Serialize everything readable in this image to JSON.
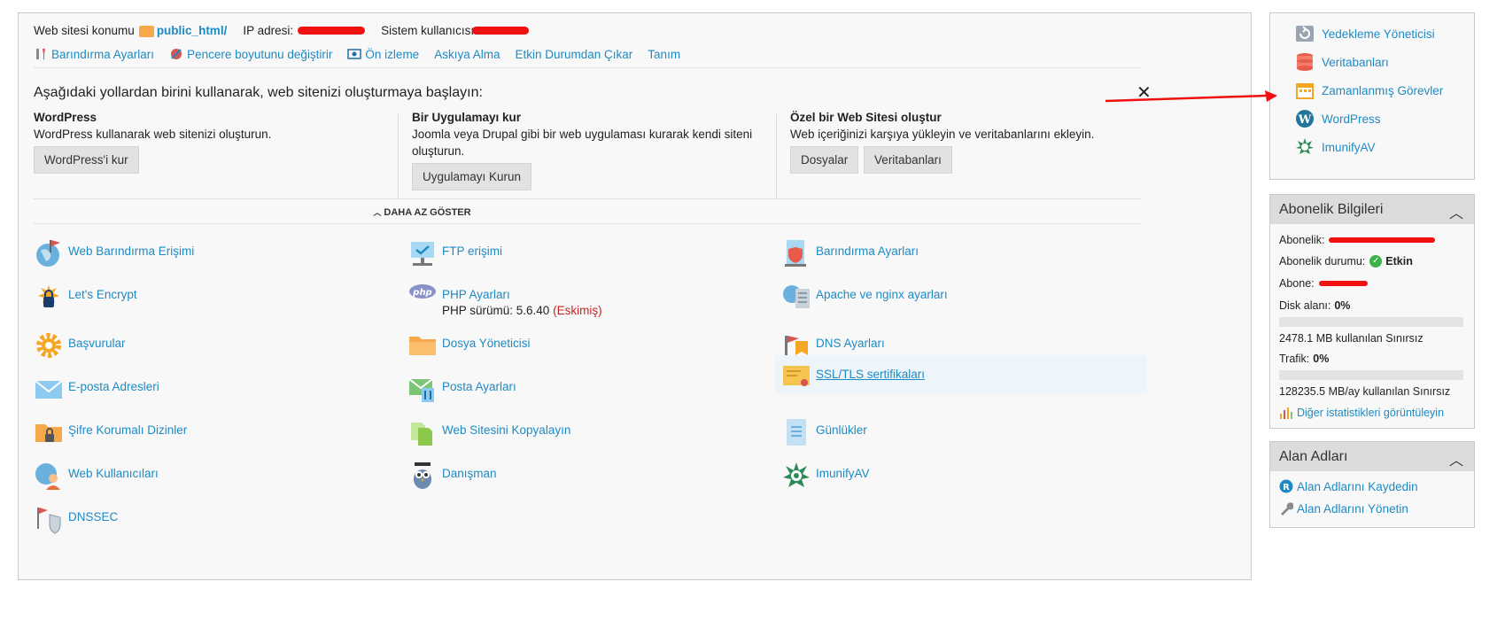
{
  "info": {
    "site_location_label": "Web sitesi konumu",
    "site_location_value": "public_html/",
    "ip_label": "IP adresi:",
    "system_user_label": "Sistem kullanıcısı:"
  },
  "toolbar": {
    "items": [
      {
        "label": "Barındırma Ayarları",
        "icon": "wrench-icon"
      },
      {
        "label": "Pencere boyutunu değiştirir",
        "icon": "resize-icon"
      },
      {
        "label": "Ön izleme",
        "icon": "eye-icon"
      },
      {
        "label": "Askıya Alma",
        "icon": ""
      },
      {
        "label": "Etkin Durumdan Çıkar",
        "icon": ""
      },
      {
        "label": "Tanım",
        "icon": ""
      }
    ]
  },
  "getting_started": {
    "title": "Aşağıdaki yollardan birini kullanarak, web sitenizi oluşturmaya başlayın:",
    "close": "✕",
    "columns": [
      {
        "title": "WordPress",
        "desc": "WordPress kullanarak web sitenizi oluşturun.",
        "buttons": [
          "WordPress'i kur"
        ]
      },
      {
        "title": "Bir Uygulamayı kur",
        "desc": "Joomla veya Drupal gibi bir web uygulaması kurarak kendi siteni oluşturun.",
        "buttons": [
          "Uygulamayı Kurun"
        ]
      },
      {
        "title": "Özel bir Web Sitesi oluştur",
        "desc": "Web içeriğinizi karşıya yükleyin ve veritabanlarını ekleyin.",
        "buttons": [
          "Dosyalar",
          "Veritabanları"
        ]
      }
    ],
    "toggle_label": "DAHA AZ GÖSTER"
  },
  "tools": {
    "col1": [
      {
        "label": "Web Barındırma Erişimi",
        "icon": "globe-flag-icon"
      },
      {
        "label": "Let's Encrypt",
        "icon": "lock-icon"
      },
      {
        "label": "Başvurular",
        "icon": "gear-icon"
      },
      {
        "label": "E-posta Adresleri",
        "icon": "envelope-icon"
      },
      {
        "label": "Şifre Korumalı Dizinler",
        "icon": "folder-lock-icon"
      },
      {
        "label": "Web Kullanıcıları",
        "icon": "web-user-icon"
      },
      {
        "label": "DNSSEC",
        "icon": "shield-flag-icon"
      }
    ],
    "col2": [
      {
        "label": "FTP erişimi",
        "icon": "ftp-icon"
      },
      {
        "label": "PHP Ayarları",
        "icon": "php-icon",
        "sub_prefix": "PHP sürümü: 5.6.40",
        "sub_old": "(Eskimiş)"
      },
      {
        "label": "Dosya Yöneticisi",
        "icon": "folder-icon"
      },
      {
        "label": "Posta Ayarları",
        "icon": "mail-settings-icon"
      },
      {
        "label": "Web Sitesini Kopyalayın",
        "icon": "copy-icon"
      },
      {
        "label": "Danışman",
        "icon": "owl-icon"
      }
    ],
    "col3": [
      {
        "label": "Barındırma Ayarları",
        "icon": "hosting-shield-icon"
      },
      {
        "label": "Apache ve nginx ayarları",
        "icon": "apache-icon"
      },
      {
        "label": "DNS Ayarları",
        "icon": "dns-flag-icon"
      },
      {
        "label": "SSL/TLS sertifikaları",
        "icon": "certificate-icon"
      },
      {
        "label": "Günlükler",
        "icon": "logs-icon"
      },
      {
        "label": "ImunifyAV",
        "icon": "imunify-icon"
      }
    ]
  },
  "sidebar": {
    "quick_links": [
      {
        "label": "Yedekleme Yöneticisi",
        "icon": "backup-icon"
      },
      {
        "label": "Veritabanları",
        "icon": "database-icon"
      },
      {
        "label": "Zamanlanmış Görevler",
        "icon": "calendar-icon"
      },
      {
        "label": "WordPress",
        "icon": "wordpress-icon"
      },
      {
        "label": "ImunifyAV",
        "icon": "imunify-icon"
      }
    ],
    "subscription": {
      "title": "Abonelik Bilgileri",
      "subscription_label": "Abonelik:",
      "status_label": "Abonelik durumu:",
      "status_value": "Etkin",
      "subscriber_label": "Abone:",
      "disk_label": "Disk alanı:",
      "disk_value": "0%",
      "disk_usage": "2478.1 MB kullanılan Sınırsız",
      "traffic_label": "Trafik:",
      "traffic_value": "0%",
      "traffic_usage": "128235.5 MB/ay kullanılan Sınırsız",
      "stats_link": "Diğer istatistikleri görüntüleyin"
    },
    "domains": {
      "title": "Alan Adları",
      "register": "Alan Adlarını Kaydedin",
      "manage": "Alan Adlarını Yönetin"
    }
  },
  "colors": {
    "link": "#1e8ac3",
    "annotation_red": "#f01010"
  }
}
